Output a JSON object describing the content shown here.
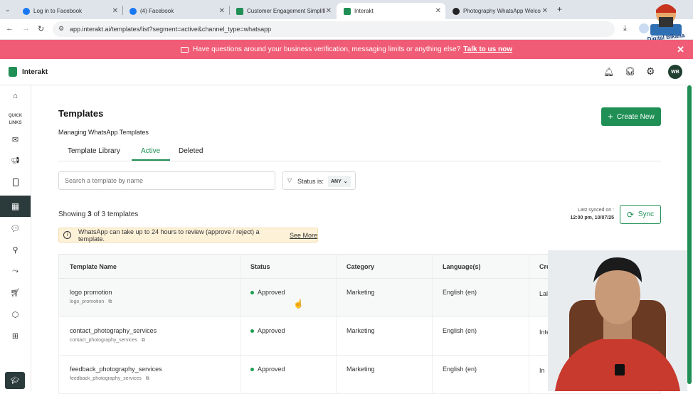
{
  "browser": {
    "tabs": [
      {
        "label": "Log in to Facebook",
        "icon": "facebook-icon"
      },
      {
        "label": "(4) Facebook",
        "icon": "facebook-icon"
      },
      {
        "label": "Customer Engagement Simplifi",
        "icon": "interakt-icon"
      },
      {
        "label": "Interakt",
        "icon": "interakt-icon"
      },
      {
        "label": "Photography WhatsApp Welco",
        "icon": "chatgpt-icon"
      }
    ],
    "url": "app.interakt.ai/templates/list?segment=active&channel_type=whatsapp"
  },
  "banner": {
    "text": "Have questions around your business verification, messaging limits or anything else?",
    "link": "Talk to us now"
  },
  "header": {
    "brand": "Interakt",
    "avatar": "WB"
  },
  "sidebar": {
    "quick_links": "QUICK LINKS"
  },
  "page": {
    "title": "Templates",
    "subtitle": "Managing WhatsApp Templates",
    "create_button": "Create New",
    "tabs": [
      "Template Library",
      "Active",
      "Deleted"
    ],
    "search_placeholder": "Search a template by name",
    "status_filter_label": "Status is:",
    "status_filter_value": "ANY",
    "showing": {
      "prefix": "Showing",
      "count": "3",
      "suffix": "of 3 templates"
    },
    "last_synced_label": "Last synced on :",
    "last_synced_value": "12:00 pm, 10/07/25",
    "sync_button": "Sync",
    "notice": "WhatsApp can take up to 24 hours to review (approve / reject) a template.",
    "notice_link": "See More"
  },
  "table": {
    "headers": [
      "Template Name",
      "Status",
      "Category",
      "Language(s)",
      "Created By"
    ],
    "rows": [
      {
        "name": "logo promotion",
        "id": "logo_promotion",
        "status": "Approved",
        "category": "Marketing",
        "language": "English (en)",
        "created_by": "Lalit Suthar"
      },
      {
        "name": "contact_photography_services",
        "id": "contact_photography_services",
        "status": "Approved",
        "category": "Marketing",
        "language": "English (en)",
        "created_by": "Interakt"
      },
      {
        "name": "feedback_photography_services",
        "id": "feedback_photography_services",
        "status": "Approved",
        "category": "Marketing",
        "language": "English (en)",
        "created_by": "In"
      }
    ]
  },
  "colors": {
    "brand_green": "#1f8f55",
    "banner_pink": "#f05c76",
    "notice_bg": "#fdf1d8",
    "sidebar_active": "#2b3a3a"
  }
}
